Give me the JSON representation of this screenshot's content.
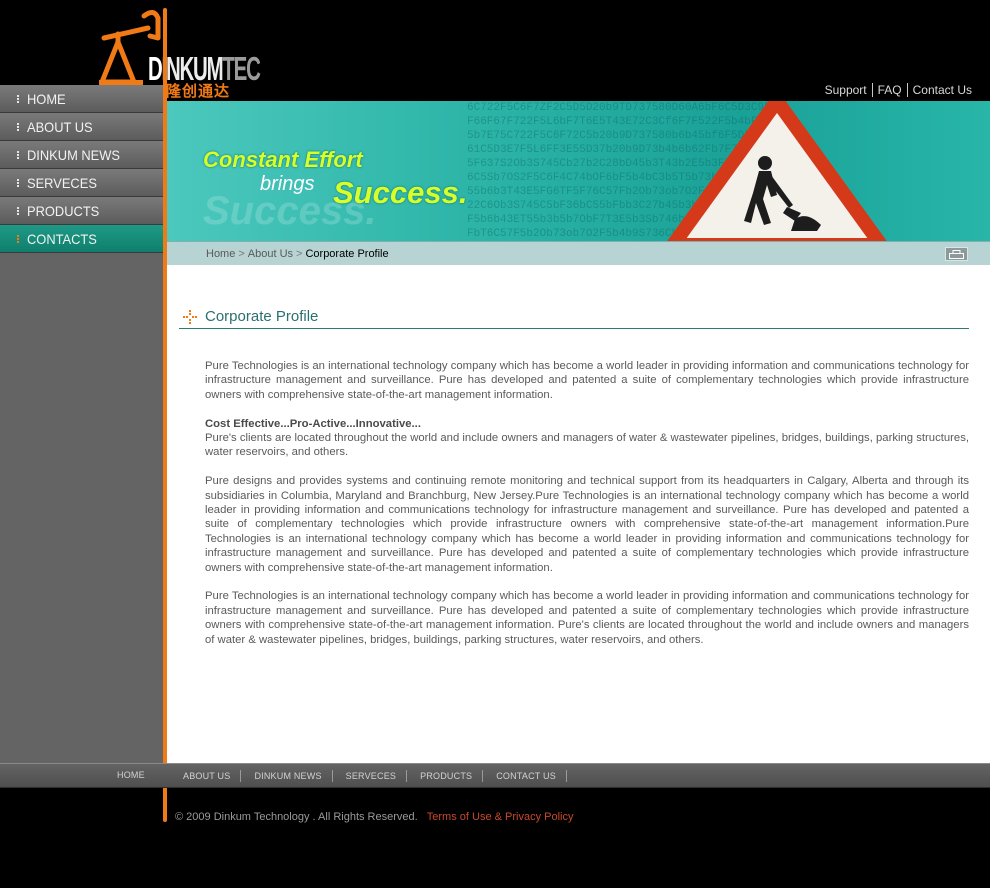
{
  "brand": {
    "name_part1": "D",
    "name_part2": "INKUM",
    "name_part3": "TEC",
    "chinese_name": "隆创通达",
    "accent_color": "#f07a16"
  },
  "top_links": [
    "Support",
    "FAQ",
    "Contact Us"
  ],
  "sidebar": {
    "items": [
      {
        "label": "HOME",
        "active": false
      },
      {
        "label": "ABOUT US",
        "active": false
      },
      {
        "label": "DINKUM NEWS",
        "active": false
      },
      {
        "label": "SERVECES",
        "active": false
      },
      {
        "label": "PRODUCTS",
        "active": false
      },
      {
        "label": "CONTACTS",
        "active": true
      }
    ],
    "active_color": "#138a77"
  },
  "banner": {
    "line1": "Constant Effort",
    "line2": "brings",
    "line3": "Success.",
    "ghost": "Success.",
    "sign_icon": "road-works-warning-sign"
  },
  "breadcrumb": {
    "items": [
      "Home",
      "About Us",
      "Corporate Profile"
    ],
    "print_icon": "print-icon"
  },
  "section": {
    "title": "Corporate Profile"
  },
  "article": {
    "p1": "Pure Technologies is an international technology company which has become a world leader in providing information and communications technology for infrastructure management and surveillance. Pure has developed and patented a suite of complementary technologies which provide infrastructure owners with comprehensive state-of-the-art management information.",
    "subheading": "Cost Effective...Pro-Active...Innovative...",
    "p2": "Pure's clients are located throughout the world and include owners and managers of water & wastewater pipelines, bridges, buildings, parking structures, water reservoirs, and others.",
    "p3": "Pure designs and provides systems and continuing remote monitoring and technical support from its headquarters in Calgary, Alberta and through its subsidiaries in Columbia, Maryland and Branchburg, New Jersey.Pure Technologies is an international technology company which has become a world leader in providing information and communications technology for infrastructure management and surveillance. Pure has developed and patented a suite of complementary technologies which provide infrastructure owners with comprehensive state-of-the-art management information.Pure Technologies is an international technology company which has become a world leader in providing information and communications technology for infrastructure management and surveillance. Pure has developed and patented a suite of complementary technologies which provide infrastructure owners with comprehensive state-of-the-art management information.",
    "p4": "Pure Technologies is an international technology company which has become a world leader in providing information and communications technology for infrastructure management and surveillance. Pure has developed and patented a suite of complementary technologies which provide infrastructure owners with comprehensive state-of-the-art management information. Pure's clients are located throughout the world and include owners and managers of water & wastewater pipelines, bridges, buildings, parking structures, water reservoirs, and others."
  },
  "footer_nav": {
    "home": "HOME",
    "links": [
      "ABOUT US",
      "DINKUM NEWS",
      "SERVECES",
      "PRODUCTS",
      "CONTACT US"
    ]
  },
  "footer": {
    "copyright": "© 2009 Dinkum Technology . All Rights Reserved.",
    "terms": "Terms of Use & Privacy Policy"
  }
}
